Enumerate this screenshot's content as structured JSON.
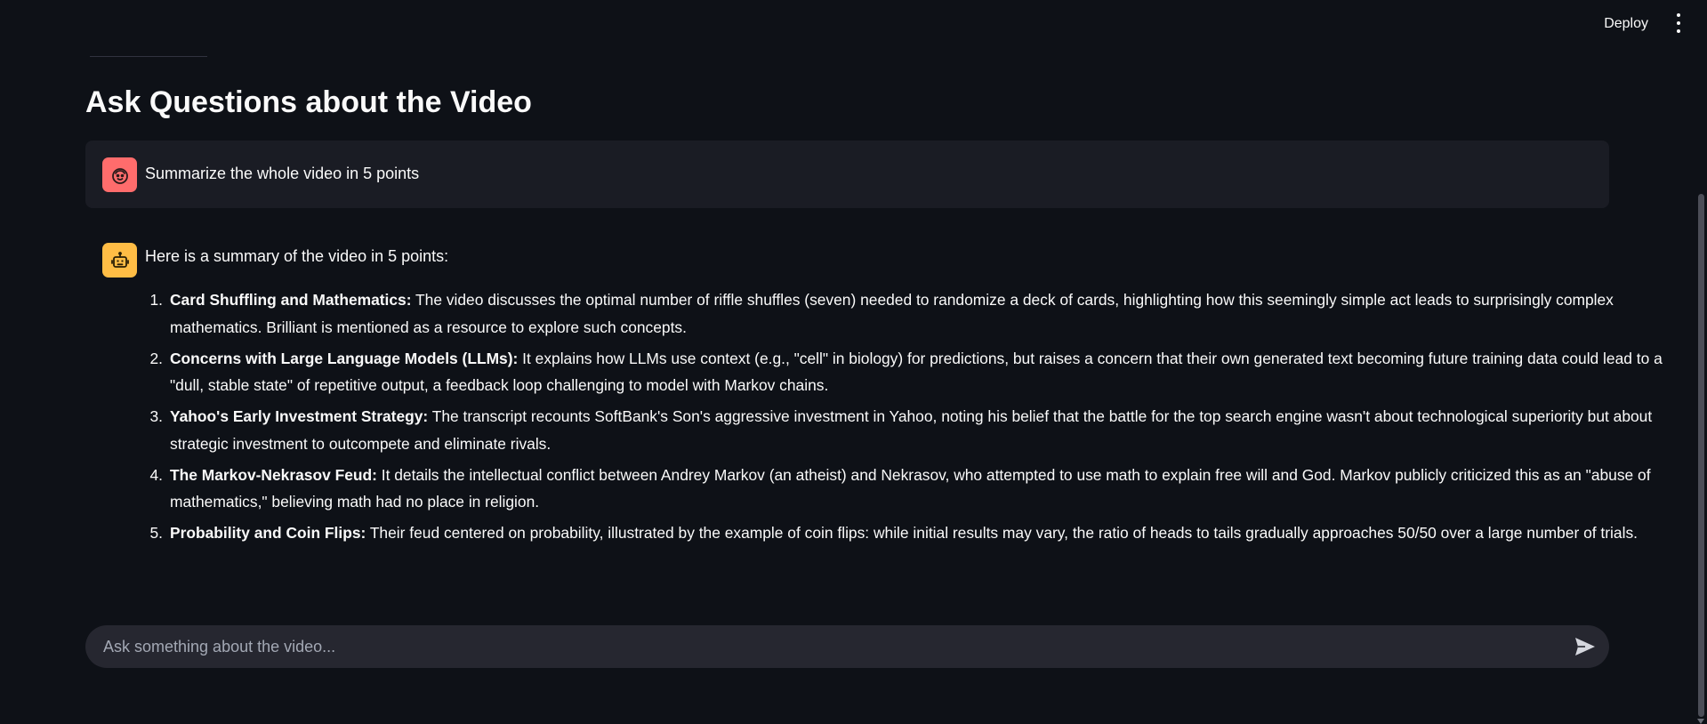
{
  "header": {
    "deploy_label": "Deploy",
    "menu_icon": "kebab-menu-icon"
  },
  "page": {
    "title": "Ask Questions about the Video"
  },
  "messages": {
    "user": {
      "avatar_icon": "user-face-icon",
      "avatar_color": "#ff6c6c",
      "text": "Summarize the whole video in 5 points"
    },
    "assistant": {
      "avatar_icon": "robot-icon",
      "avatar_color": "#ffbd45",
      "intro": "Here is a summary of the video in 5 points:",
      "points": [
        {
          "num": "1.",
          "title": "Card Shuffling and Mathematics:",
          "body": " The video discusses the optimal number of riffle shuffles (seven) needed to randomize a deck of cards, highlighting how this seemingly simple act leads to surprisingly complex mathematics. Brilliant is mentioned as a resource to explore such concepts."
        },
        {
          "num": "2.",
          "title": "Concerns with Large Language Models (LLMs):",
          "body": " It explains how LLMs use context (e.g., \"cell\" in biology) for predictions, but raises a concern that their own generated text becoming future training data could lead to a \"dull, stable state\" of repetitive output, a feedback loop challenging to model with Markov chains."
        },
        {
          "num": "3.",
          "title": "Yahoo's Early Investment Strategy:",
          "body": " The transcript recounts SoftBank's Son's aggressive investment in Yahoo, noting his belief that the battle for the top search engine wasn't about technological superiority but about strategic investment to outcompete and eliminate rivals."
        },
        {
          "num": "4.",
          "title": "The Markov-Nekrasov Feud:",
          "body": " It details the intellectual conflict between Andrey Markov (an atheist) and Nekrasov, who attempted to use math to explain free will and God. Markov publicly criticized this as an \"abuse of mathematics,\" believing math had no place in religion."
        },
        {
          "num": "5.",
          "title": "Probability and Coin Flips:",
          "body": " Their feud centered on probability, illustrated by the example of coin flips: while initial results may vary, the ratio of heads to tails gradually approaches 50/50 over a large number of trials."
        }
      ]
    }
  },
  "chat_input": {
    "placeholder": "Ask something about the video...",
    "value": "",
    "send_icon": "send-icon"
  },
  "colors": {
    "background": "#0e1117",
    "surface": "#1a1c24",
    "input": "#262730",
    "text": "#fafafa",
    "muted": "#a3a8b4"
  }
}
